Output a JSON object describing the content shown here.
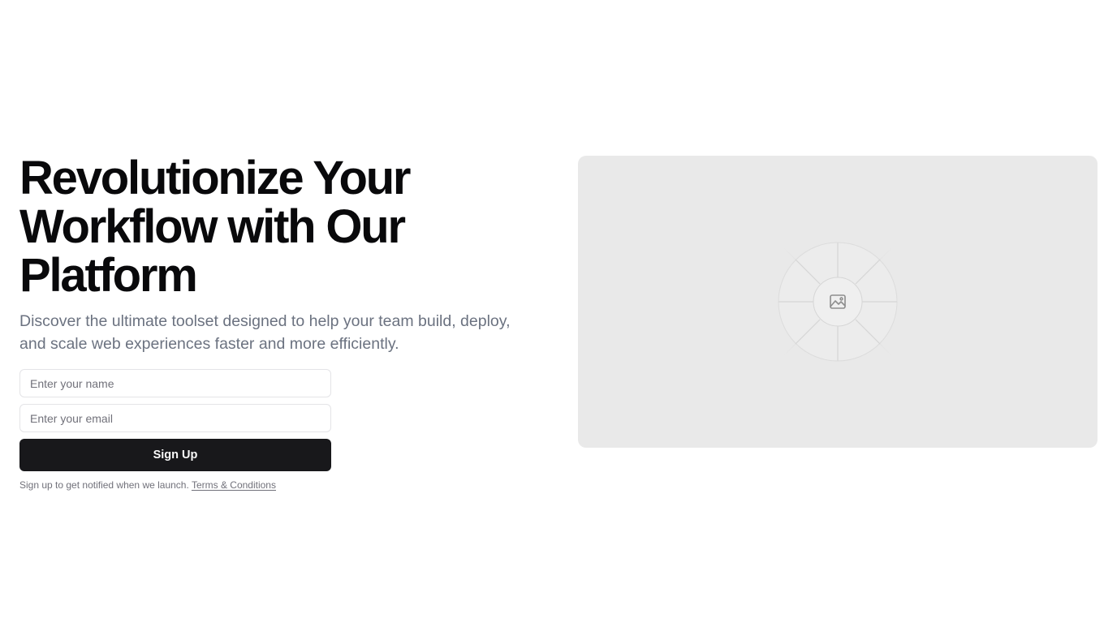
{
  "hero": {
    "title": "Revolutionize Your Workflow with Our Platform",
    "subtitle": "Discover the ultimate toolset designed to help your team build, deploy, and scale web experiences faster and more efficiently."
  },
  "form": {
    "name_placeholder": "Enter your name",
    "email_placeholder": "Enter your email",
    "submit_label": "Sign Up",
    "note_text": "Sign up to get notified when we launch.",
    "terms_link": "Terms & Conditions"
  },
  "media": {
    "placeholder_icon": "image-icon"
  },
  "colors": {
    "button_bg": "#18181b",
    "placeholder_bg": "#e9e9e9",
    "muted_text": "#6b7280"
  }
}
